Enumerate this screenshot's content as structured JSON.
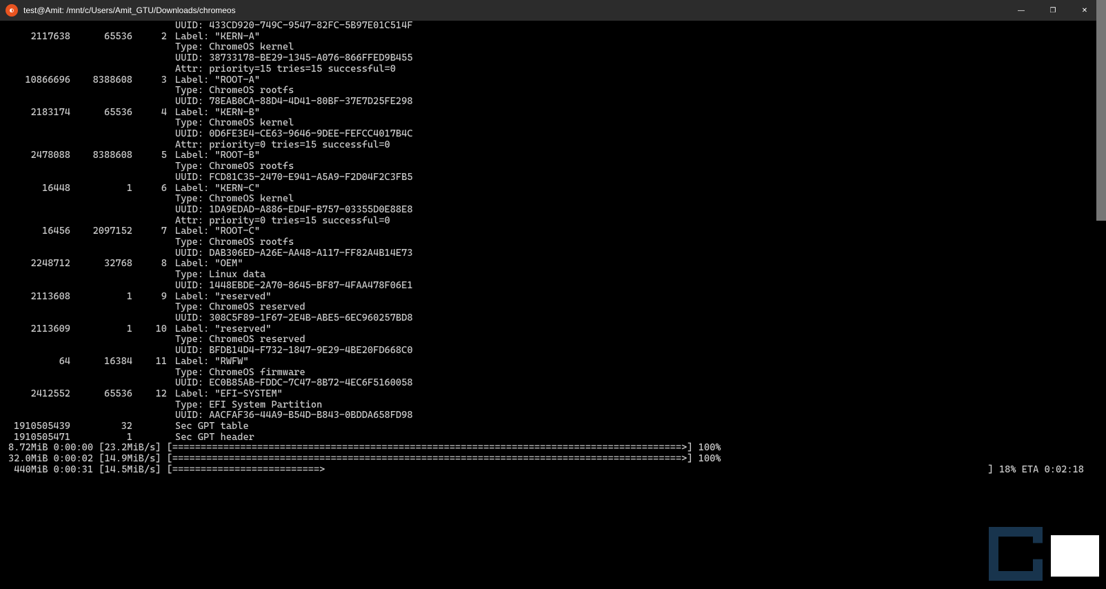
{
  "window": {
    "title": "test@Amit: /mnt/c/Users/Amit_GTU/Downloads/chromeos",
    "icon_glyph": "◐"
  },
  "win_controls": {
    "min": "—",
    "max": "❐",
    "close": "✕"
  },
  "lines": [
    {
      "type": "detail",
      "detail": "UUID: 433CD920-749C-9547-82FC-5B97E01C514F"
    },
    {
      "type": "part",
      "start": "2117638",
      "size": "65536",
      "num": "2",
      "detail": "Label: \"KERN-A\""
    },
    {
      "type": "detail",
      "detail": "Type: ChromeOS kernel"
    },
    {
      "type": "detail",
      "detail": "UUID: 38733178-BE29-1345-A076-866FFED9B455"
    },
    {
      "type": "detail",
      "detail": "Attr: priority=15 tries=15 successful=0"
    },
    {
      "type": "part",
      "start": "10866696",
      "size": "8388608",
      "num": "3",
      "detail": "Label: \"ROOT-A\""
    },
    {
      "type": "detail",
      "detail": "Type: ChromeOS rootfs"
    },
    {
      "type": "detail",
      "detail": "UUID: 78EAB0CA-88D4-4D41-80BF-37E7D25FE298"
    },
    {
      "type": "part",
      "start": "2183174",
      "size": "65536",
      "num": "4",
      "detail": "Label: \"KERN-B\""
    },
    {
      "type": "detail",
      "detail": "Type: ChromeOS kernel"
    },
    {
      "type": "detail",
      "detail": "UUID: 0D6FE3E4-CE63-9646-9DEE-FEFCC4017B4C"
    },
    {
      "type": "detail",
      "detail": "Attr: priority=0 tries=15 successful=0"
    },
    {
      "type": "part",
      "start": "2478088",
      "size": "8388608",
      "num": "5",
      "detail": "Label: \"ROOT-B\""
    },
    {
      "type": "detail",
      "detail": "Type: ChromeOS rootfs"
    },
    {
      "type": "detail",
      "detail": "UUID: FCD81C35-2470-E941-A5A9-F2D04F2C3FB5"
    },
    {
      "type": "part",
      "start": "16448",
      "size": "1",
      "num": "6",
      "detail": "Label: \"KERN-C\""
    },
    {
      "type": "detail",
      "detail": "Type: ChromeOS kernel"
    },
    {
      "type": "detail",
      "detail": "UUID: 1DA9EDAD-A886-ED4F-B757-03355D0E88E8"
    },
    {
      "type": "detail",
      "detail": "Attr: priority=0 tries=15 successful=0"
    },
    {
      "type": "part",
      "start": "16456",
      "size": "2097152",
      "num": "7",
      "detail": "Label: \"ROOT-C\""
    },
    {
      "type": "detail",
      "detail": "Type: ChromeOS rootfs"
    },
    {
      "type": "detail",
      "detail": "UUID: DAB306ED-A26E-AA48-A117-FF82A4B14E73"
    },
    {
      "type": "part",
      "start": "2248712",
      "size": "32768",
      "num": "8",
      "detail": "Label: \"OEM\""
    },
    {
      "type": "detail",
      "detail": "Type: Linux data"
    },
    {
      "type": "detail",
      "detail": "UUID: 1448EBDE-2A70-8645-BF87-4FAA478F06E1"
    },
    {
      "type": "part",
      "start": "2113608",
      "size": "1",
      "num": "9",
      "detail": "Label: \"reserved\""
    },
    {
      "type": "detail",
      "detail": "Type: ChromeOS reserved"
    },
    {
      "type": "detail",
      "detail": "UUID: 308C5F89-1F67-2E4B-ABE5-6EC960257BD8"
    },
    {
      "type": "part",
      "start": "2113609",
      "size": "1",
      "num": "10",
      "detail": "Label: \"reserved\""
    },
    {
      "type": "detail",
      "detail": "Type: ChromeOS reserved"
    },
    {
      "type": "detail",
      "detail": "UUID: BFDB14D4-F732-1847-9E29-4BE20FD668C0"
    },
    {
      "type": "part",
      "start": "64",
      "size": "16384",
      "num": "11",
      "detail": "Label: \"RWFW\""
    },
    {
      "type": "detail",
      "detail": "Type: ChromeOS firmware"
    },
    {
      "type": "detail",
      "detail": "UUID: EC0B85AB-FDDC-7C47-8B72-4EC6F5160058"
    },
    {
      "type": "part",
      "start": "2412552",
      "size": "65536",
      "num": "12",
      "detail": "Label: \"EFI-SYSTEM\""
    },
    {
      "type": "detail",
      "detail": "Type: EFI System Partition"
    },
    {
      "type": "detail",
      "detail": "UUID: AACFAF36-44A9-B54D-B843-0BDDA658FD98"
    },
    {
      "type": "part",
      "start": "1910505439",
      "size": "32",
      "num": "",
      "detail": "Sec GPT table"
    },
    {
      "type": "part",
      "start": "1910505471",
      "size": "1",
      "num": "",
      "detail": "Sec GPT header"
    }
  ],
  "progress": [
    {
      "prefix": "8.72MiB 0:00:00 [23.2MiB/s] [",
      "bar": "==========================================================================================>",
      "suffix": "] 100%",
      "right": ""
    },
    {
      "prefix": "32.0MiB 0:00:02 [14.9MiB/s] [",
      "bar": "==========================================================================================>",
      "suffix": "] 100%",
      "right": ""
    },
    {
      "prefix": " 440MiB 0:00:31 [14.5MiB/s] [",
      "bar": "==========================>",
      "suffix": "",
      "right": "] 18% ETA 0:02:18"
    }
  ]
}
